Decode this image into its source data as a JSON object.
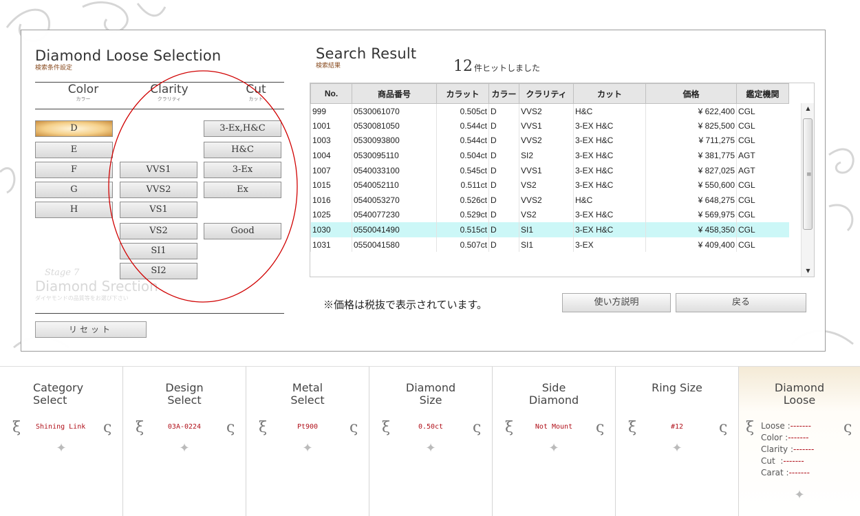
{
  "selection": {
    "title": "Diamond Loose Selection",
    "subtitle": "検索条件設定",
    "columns": [
      {
        "en": "Color",
        "jp": "カラー"
      },
      {
        "en": "Clarity",
        "jp": "クラリティ"
      },
      {
        "en": "Cut",
        "jp": "カット"
      }
    ],
    "color_buttons": [
      "D",
      "E",
      "F",
      "G",
      "H"
    ],
    "active_color": "D",
    "clarity_buttons": [
      "VVS1",
      "VVS2",
      "VS1",
      "VS2",
      "SI1",
      "SI2"
    ],
    "cut_buttons": [
      "3-Ex,H&C",
      "H&C",
      "3-Ex",
      "Ex",
      "Good"
    ],
    "reset_label": "リセット",
    "watermark": {
      "stage": "Stage 7",
      "title": "Diamond Srection",
      "sub": "ダイヤモンドの品質等をお選び下さい"
    }
  },
  "results": {
    "title": "Search Result",
    "subtitle": "検索結果",
    "hit_count": "12",
    "hit_text": "件ヒットしました",
    "headers": [
      "No.",
      "商品番号",
      "カラット",
      "カラー",
      "クラリティ",
      "カット",
      "価格",
      "鑑定機関"
    ],
    "rows": [
      [
        "999",
        "0530061070",
        "0.505ct",
        "D",
        "VVS2",
        "H&C",
        "¥ 622,400",
        "CGL"
      ],
      [
        "1001",
        "0530081050",
        "0.544ct",
        "D",
        "VVS1",
        "3-EX H&C",
        "¥ 825,500",
        "CGL"
      ],
      [
        "1003",
        "0530093800",
        "0.544ct",
        "D",
        "VVS2",
        "3-EX H&C",
        "¥ 711,275",
        "CGL"
      ],
      [
        "1004",
        "0530095110",
        "0.504ct",
        "D",
        "SI2",
        "3-EX H&C",
        "¥ 381,775",
        "AGT"
      ],
      [
        "1007",
        "0540033100",
        "0.545ct",
        "D",
        "VVS1",
        "3-EX H&C",
        "¥ 827,025",
        "AGT"
      ],
      [
        "1015",
        "0540052110",
        "0.511ct",
        "D",
        "VS2",
        "3-EX H&C",
        "¥ 550,600",
        "CGL"
      ],
      [
        "1016",
        "0540053270",
        "0.526ct",
        "D",
        "VVS2",
        "H&C",
        "¥ 648,275",
        "CGL"
      ],
      [
        "1025",
        "0540077230",
        "0.529ct",
        "D",
        "VS2",
        "3-EX H&C",
        "¥ 569,975",
        "CGL"
      ],
      [
        "1030",
        "0550041490",
        "0.515ct",
        "D",
        "SI1",
        "3-EX H&C",
        "¥ 458,350",
        "CGL"
      ],
      [
        "1031",
        "0550041580",
        "0.507ct",
        "D",
        "SI1",
        "3-EX",
        "¥ 409,400",
        "CGL"
      ]
    ],
    "highlight_row": 8,
    "note": "※価格は税抜で表示されています。",
    "howto_label": "使い方説明",
    "back_label": "戻る"
  },
  "steps": [
    {
      "label": "Category\nSelect",
      "value": "Shining Link"
    },
    {
      "label": "Design\nSelect",
      "value": "03A-0224"
    },
    {
      "label": "Metal\nSelect",
      "value": "Pt900"
    },
    {
      "label": "Diamond\nSize",
      "value": "0.50ct"
    },
    {
      "label": "Side\nDiamond",
      "value": "Not Mount"
    },
    {
      "label": "Ring Size",
      "value": "#12"
    }
  ],
  "loose_step": {
    "label": "Diamond\nLoose",
    "items": [
      {
        "key": "Loose",
        "value": "-------"
      },
      {
        "key": "Color",
        "value": "-------"
      },
      {
        "key": "Clarity",
        "value": "-------"
      },
      {
        "key": "Cut",
        "value": "-------"
      },
      {
        "key": "Carat",
        "value": "-------"
      }
    ]
  },
  "colors": {
    "accent_red": "#b0101a",
    "highlight_row": "#ccf7f7",
    "annotation_circle": "#d00000"
  }
}
